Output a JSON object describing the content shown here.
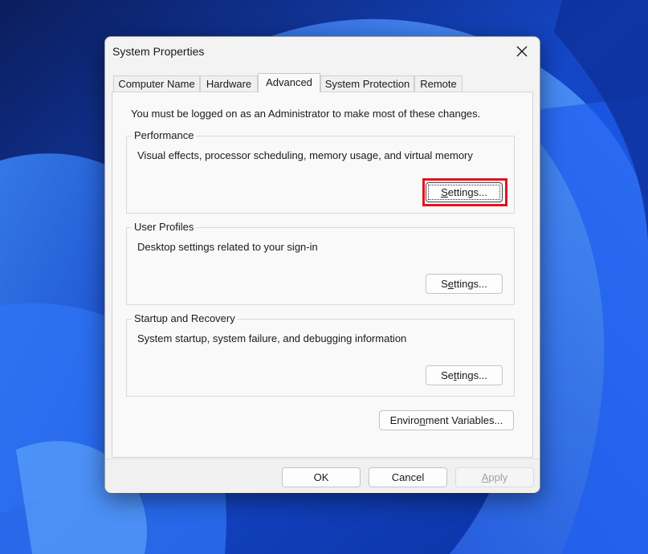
{
  "dialog": {
    "title": "System Properties",
    "close_icon": "close-icon"
  },
  "tabs": [
    {
      "label": "Computer Name",
      "active": false
    },
    {
      "label": "Hardware",
      "active": false
    },
    {
      "label": "Advanced",
      "active": true
    },
    {
      "label": "System Protection",
      "active": false
    },
    {
      "label": "Remote",
      "active": false
    }
  ],
  "advanced": {
    "admin_note": "You must be logged on as an Administrator to make most of these changes.",
    "performance": {
      "label": "Performance",
      "description": "Visual effects, processor scheduling, memory usage, and virtual memory",
      "button": {
        "accel": "S",
        "rest": "ettings..."
      }
    },
    "user_profiles": {
      "label": "User Profiles",
      "description": "Desktop settings related to your sign-in",
      "button": {
        "pre": "S",
        "accel": "e",
        "rest": "ttings..."
      }
    },
    "startup_recovery": {
      "label": "Startup and Recovery",
      "description": "System startup, system failure, and debugging information",
      "button": {
        "pre": "Se",
        "accel": "t",
        "rest": "tings..."
      }
    },
    "env_button": {
      "pre": "Enviro",
      "accel": "n",
      "rest": "ment Variables..."
    }
  },
  "footer": {
    "ok": "OK",
    "cancel": "Cancel",
    "apply": {
      "accel": "A",
      "rest": "pply"
    }
  },
  "colors": {
    "highlight_border": "#e0141e",
    "wallpaper_base": "#0a2a8a"
  }
}
